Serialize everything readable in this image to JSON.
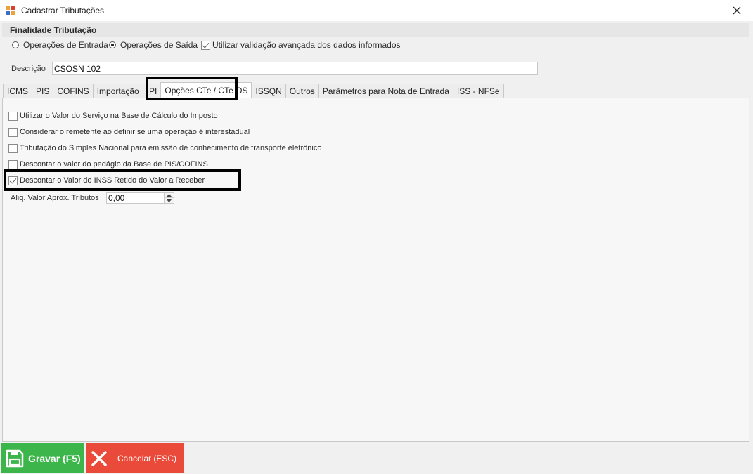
{
  "window": {
    "title": "Cadastrar Tributações",
    "app_icon": "app-form-icon",
    "close_icon": "close-icon"
  },
  "finalidade": {
    "title": "Finalidade Tributação",
    "radios": [
      {
        "label": "Operações de Entrada",
        "checked": false
      },
      {
        "label": "Operações de Saída",
        "checked": true
      }
    ],
    "validacao_label": "Utilizar validação avançada dos dados informados",
    "validacao_checked": true
  },
  "descricao": {
    "label": "Descrição",
    "value": "CSOSN 102"
  },
  "tabs": [
    {
      "label": "ICMS",
      "active": false
    },
    {
      "label": "PIS",
      "active": false
    },
    {
      "label": "COFINS",
      "active": false
    },
    {
      "label": "Importação",
      "active": false
    },
    {
      "label": "IPI",
      "active": false
    },
    {
      "label": "Opções CTe / CTe OS",
      "active": true
    },
    {
      "label": "ISSQN",
      "active": false
    },
    {
      "label": "Outros",
      "active": false
    },
    {
      "label": "Parâmetros para Nota de Entrada",
      "active": false
    },
    {
      "label": "ISS - NFSe",
      "active": false
    }
  ],
  "options": [
    {
      "label": "Utilizar o Valor do Serviço na Base de Cálculo do Imposto",
      "checked": false
    },
    {
      "label": "Considerar o remetente ao definir se uma operação é interestadual",
      "checked": false
    },
    {
      "label": "Tributação do Simples Nacional para emissão de conhecimento de transporte eletrônico",
      "checked": false
    },
    {
      "label": "Descontar o valor do pedágio da Base de PIS/COFINS",
      "checked": false
    },
    {
      "label": "Descontar o Valor do INSS Retido do Valor a Receber",
      "checked": true
    }
  ],
  "aliq": {
    "label": "Aliq. Valor Aprox. Tributos",
    "value": "0,00"
  },
  "buttons": {
    "save_label": "Gravar (F5)",
    "save_icon": "floppy-disk-icon",
    "save_color": "#3cb54a",
    "cancel_label": "Cancelar (ESC)",
    "cancel_icon": "x-icon",
    "cancel_color": "#ea4a3a"
  }
}
